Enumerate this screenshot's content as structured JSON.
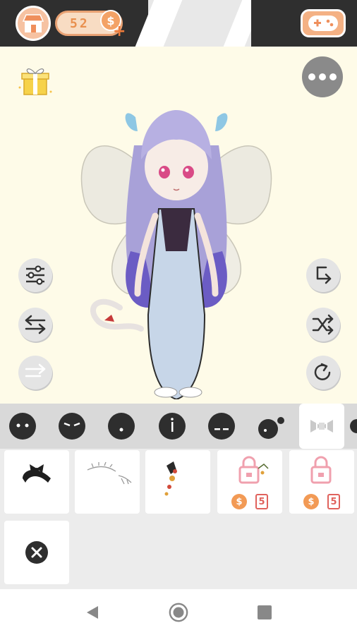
{
  "header": {
    "coins": "52",
    "coin_symbol": "$",
    "coin_plus": "+"
  },
  "stage": {
    "background_color": "#fefbe8",
    "left_tools": [
      "sliders-icon",
      "swap-arrows-icon",
      "forward-arrows-icon"
    ],
    "right_tools": [
      "export-icon",
      "shuffle-icon",
      "redo-icon"
    ]
  },
  "categories": [
    {
      "name": "face-neutral",
      "selected": false
    },
    {
      "name": "face-sleepy",
      "selected": false
    },
    {
      "name": "face-mouth",
      "selected": false
    },
    {
      "name": "face-nose",
      "selected": false
    },
    {
      "name": "face-blush",
      "selected": false
    },
    {
      "name": "body",
      "selected": false
    },
    {
      "name": "accessory-bow",
      "selected": true
    }
  ],
  "items": [
    {
      "kind": "hair-bow",
      "locked": false
    },
    {
      "kind": "eyelash-sketch",
      "locked": false
    },
    {
      "kind": "flower-pin",
      "locked": false
    },
    {
      "kind": "locked-item",
      "locked": true,
      "price_symbol": "$",
      "price": "5"
    },
    {
      "kind": "locked-item",
      "locked": true,
      "price_symbol": "$",
      "price": "5"
    },
    {
      "kind": "remove",
      "locked": false
    }
  ]
}
